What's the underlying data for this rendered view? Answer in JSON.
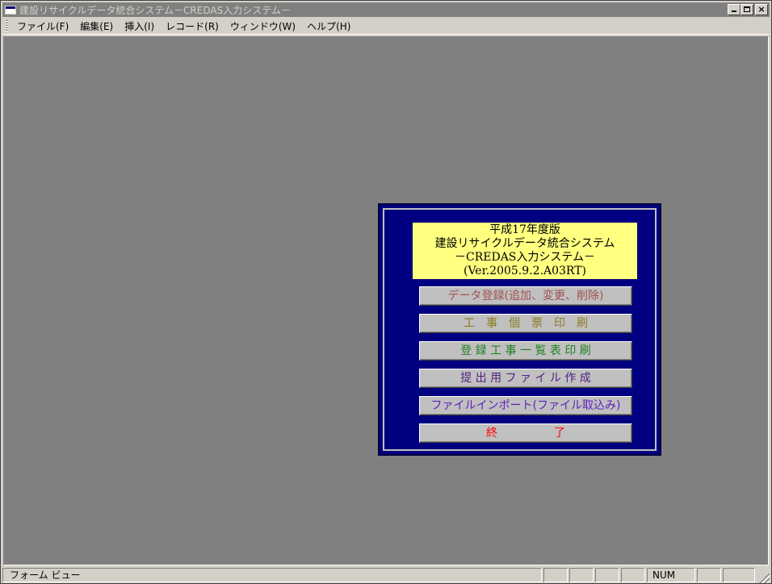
{
  "window": {
    "title": "建設リサイクルデータ統合システム－CREDAS入力システム－",
    "controls": {
      "minimize": "_",
      "maximize": "□",
      "close": "×"
    }
  },
  "menubar": {
    "items": [
      {
        "label": "ファイル(F)"
      },
      {
        "label": "編集(E)"
      },
      {
        "label": "挿入(I)"
      },
      {
        "label": "レコード(R)"
      },
      {
        "label": "ウィンドウ(W)"
      },
      {
        "label": "ヘルプ(H)"
      }
    ]
  },
  "dialog": {
    "banner": {
      "line1": "平成17年度版",
      "line2": "建設リサイクルデータ統合システム",
      "line3": "－CREDAS入力システム－",
      "line4": "(Ver.2005.9.2.A03RT)"
    },
    "buttons": [
      {
        "label": "データ登録(追加、変更、削除)",
        "color": "#a05050"
      },
      {
        "label": "工　事　個　票　印　刷",
        "color": "#8a7a20"
      },
      {
        "label": "登 録 工 事 一 覧 表 印 刷",
        "color": "#208020"
      },
      {
        "label": "提 出 用 フ ァ イ ル 作 成",
        "color": "#502080"
      },
      {
        "label": "ファイルインポート(ファイル取込み)",
        "color": "#6020c0"
      },
      {
        "label": "終　　　　　了",
        "color": "#ff0000"
      }
    ]
  },
  "statusbar": {
    "view_label": "フォーム ビュー",
    "num_label": "NUM"
  },
  "colors": {
    "mdi_background": "#808080",
    "dialog_background": "#000080",
    "banner_background": "#ffff80",
    "titlebar_inactive": "#808080"
  }
}
